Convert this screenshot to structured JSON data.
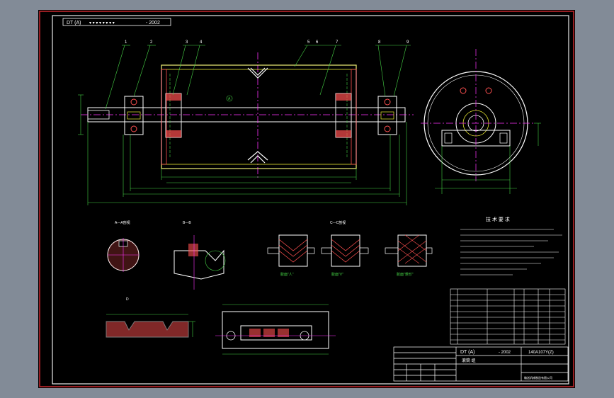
{
  "drawing": {
    "code_label": "DT (A)",
    "code_dots": "▾ ▾ ▾ ▾ ▾ ▾ ▾ ▾",
    "code_year": "- 2002",
    "part_numbers": [
      "1",
      "2",
      "3",
      "4",
      "5",
      "6",
      "7",
      "8",
      "9"
    ],
    "datum_label": "A",
    "tech_title": "技 术 要 求",
    "section_labels": [
      "A—A剖视",
      "B—B",
      "C—C剖视",
      "D"
    ],
    "view_labels": [
      "胶面\"人\"",
      "胶面\"V\"",
      "胶面\"菱形\""
    ],
    "title_block": {
      "code": "DT (A)",
      "year": "- 2002",
      "drawing_no": "140A107Y(Z)",
      "name": "滚筒 组",
      "company": "输送机械制造有限公司"
    }
  },
  "colors": {
    "background": "#828b97",
    "sheet": "#000000",
    "outer_border": "#c8282d",
    "inner_border": "#e8e8e8",
    "outline": "#ffffff",
    "dimension": "#45d245",
    "centerline": "#ff33ff",
    "hidden": "#e8e833",
    "hatch": "#ff5050",
    "text_white": "#ffffff"
  }
}
